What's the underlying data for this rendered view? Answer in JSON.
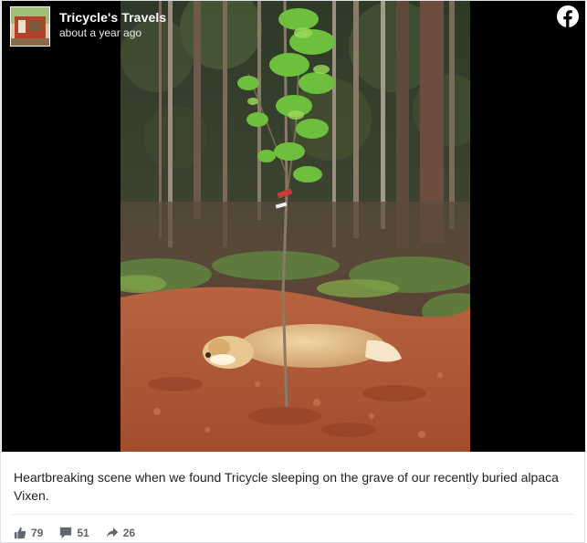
{
  "post": {
    "page_name": "Tricycle's Travels",
    "timestamp": "about a year ago",
    "caption": "Heartbreaking scene when we found Tricycle sleeping on the grave of our recently buried alpaca Vixen.",
    "photo_icon": "photo-dog-on-grave",
    "brand_icon": "facebook-logo-icon"
  },
  "stats": {
    "likes": "79",
    "comments": "51",
    "shares": "26",
    "like_icon": "thumbs-up-icon",
    "comment_icon": "comment-icon",
    "share_icon": "share-arrow-icon"
  },
  "colors": {
    "brand_blue": "#1877f2",
    "text": "#1c1e21",
    "muted": "#606770",
    "border": "#dddfe2"
  }
}
